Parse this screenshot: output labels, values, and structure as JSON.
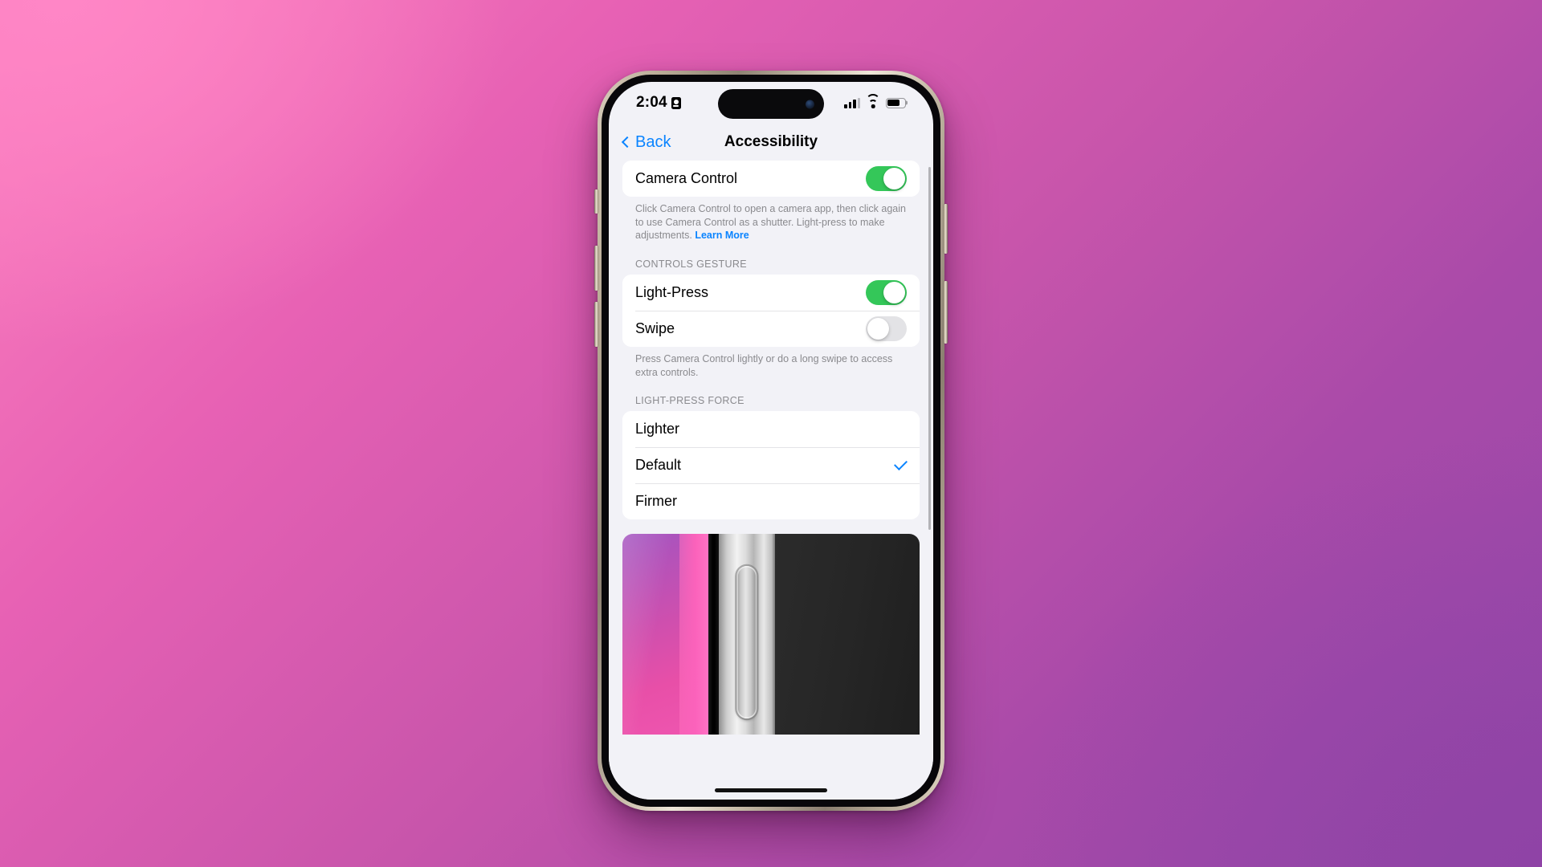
{
  "status_bar": {
    "time": "2:04",
    "recording_icon": "id-card-icon",
    "signal_icon": "cellular-signal-icon",
    "wifi_icon": "wifi-icon",
    "battery_icon": "battery-icon",
    "battery_level_percent": 72
  },
  "nav": {
    "back_label": "Back",
    "back_icon": "chevron-left-icon",
    "title": "Accessibility"
  },
  "sections": {
    "camera_control": {
      "row_label": "Camera Control",
      "toggle_state": "on",
      "footnote_text": "Click Camera Control to open a camera app, then click again to use Camera Control as a shutter. Light-press to make adjustments. ",
      "footnote_link": "Learn More"
    },
    "controls_gesture": {
      "header": "CONTROLS GESTURE",
      "rows": [
        {
          "label": "Light-Press",
          "toggle_state": "on"
        },
        {
          "label": "Swipe",
          "toggle_state": "off"
        }
      ],
      "footnote_text": "Press Camera Control lightly or do a long swipe to access extra controls."
    },
    "light_press_force": {
      "header": "LIGHT-PRESS FORCE",
      "options": [
        {
          "label": "Lighter",
          "selected": false
        },
        {
          "label": "Default",
          "selected": true
        },
        {
          "label": "Firmer",
          "selected": false
        }
      ],
      "checkmark_icon": "checkmark-icon"
    }
  },
  "illustration": {
    "name": "camera-control-button-illustration",
    "description": "Side view of phone showing the Camera Control button on the metallic rail"
  },
  "colors": {
    "accent_blue": "#0a84ff",
    "toggle_on_green": "#34c759",
    "toggle_off_gray": "#e3e3e6",
    "group_background": "#ffffff",
    "page_background": "#f2f2f7",
    "secondary_text": "#8a8a8e",
    "wallpaper_pink": "#fb7fbe",
    "wallpaper_purple": "#9448a8"
  }
}
